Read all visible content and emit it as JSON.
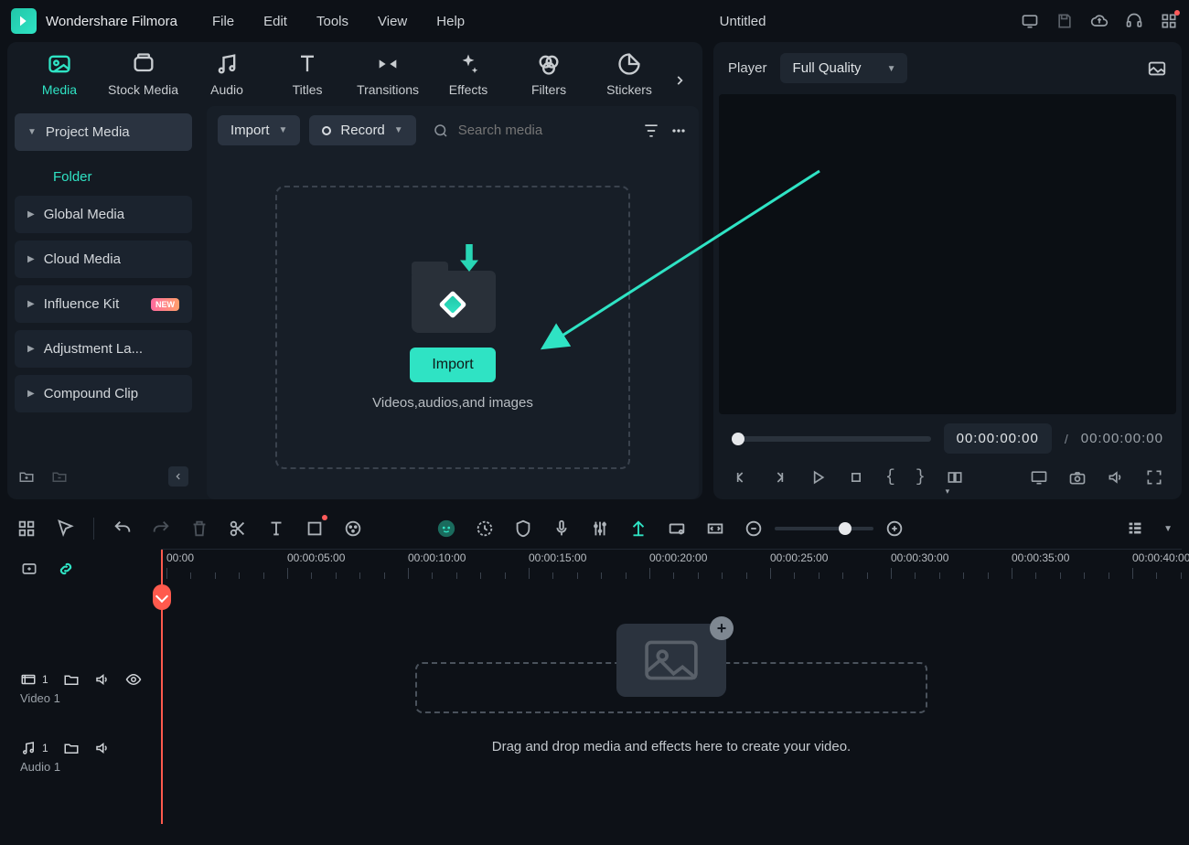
{
  "app": {
    "name": "Wondershare Filmora",
    "title": "Untitled"
  },
  "menu": [
    "File",
    "Edit",
    "Tools",
    "View",
    "Help"
  ],
  "tabs": [
    {
      "label": "Media"
    },
    {
      "label": "Stock Media"
    },
    {
      "label": "Audio"
    },
    {
      "label": "Titles"
    },
    {
      "label": "Transitions"
    },
    {
      "label": "Effects"
    },
    {
      "label": "Filters"
    },
    {
      "label": "Stickers"
    }
  ],
  "sidebar": {
    "project": "Project Media",
    "folder": "Folder",
    "items": [
      {
        "label": "Global Media"
      },
      {
        "label": "Cloud Media"
      },
      {
        "label": "Influence Kit",
        "new": "NEW"
      },
      {
        "label": "Adjustment La..."
      },
      {
        "label": "Compound Clip"
      }
    ]
  },
  "toolbar": {
    "import": "Import",
    "record": "Record",
    "search_placeholder": "Search media"
  },
  "dropzone": {
    "button": "Import",
    "text": "Videos,audios,and images"
  },
  "player": {
    "label": "Player",
    "quality": "Full Quality",
    "time_current": "00:00:00:00",
    "time_sep": "/",
    "time_total": "00:00:00:00"
  },
  "ruler": [
    "00:00",
    "00:00:05:00",
    "00:00:10:00",
    "00:00:15:00",
    "00:00:20:00",
    "00:00:25:00",
    "00:00:30:00",
    "00:00:35:00",
    "00:00:40:00"
  ],
  "tracks": {
    "video": {
      "num": "1",
      "name": "Video 1"
    },
    "audio": {
      "num": "1",
      "name": "Audio 1"
    }
  },
  "timeline_msg": "Drag and drop media and effects here to create your video."
}
